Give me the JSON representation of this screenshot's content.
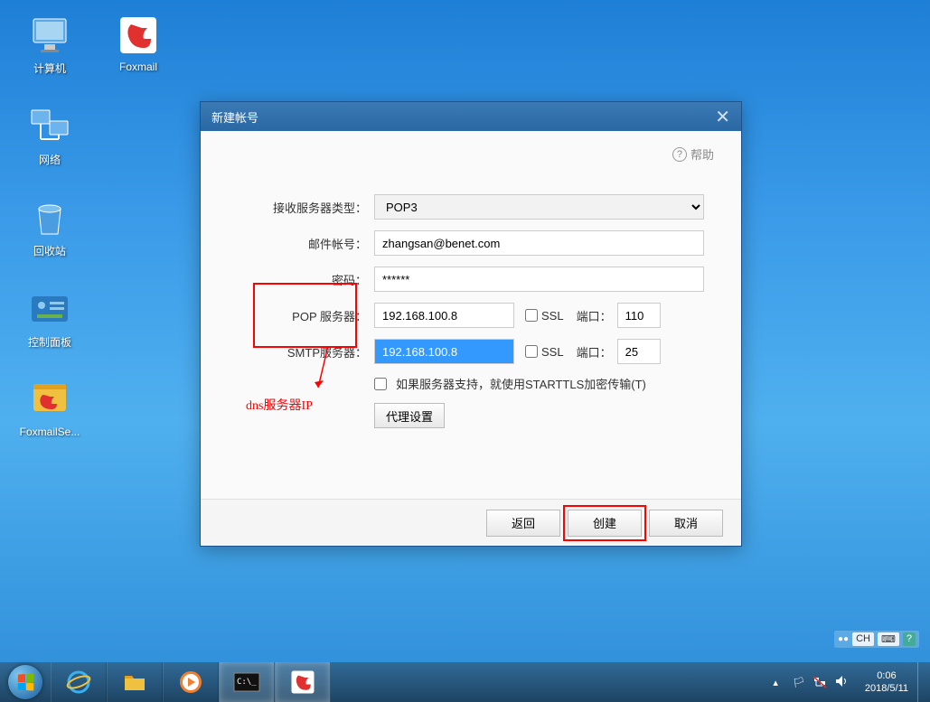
{
  "desktop": {
    "computer": "计算机",
    "foxmail": "Foxmail",
    "network": "网络",
    "recycle": "回收站",
    "control_panel": "控制面板",
    "foxmail_server": "FoxmailSe..."
  },
  "dialog": {
    "title": "新建帐号",
    "help": "帮助",
    "labels": {
      "server_type": "接收服务器类型：",
      "email": "邮件帐号：",
      "password": "密码：",
      "pop_server": "POP 服务器：",
      "smtp_server": "SMTP服务器：",
      "ssl": "SSL",
      "port": "端口：",
      "starttls": "如果服务器支持，就使用STARTTLS加密传输(T)"
    },
    "values": {
      "server_type": "POP3",
      "email": "zhangsan@benet.com",
      "password": "******",
      "pop_server": "192.168.100.8",
      "pop_port": "110",
      "smtp_server": "192.168.100.8",
      "smtp_port": "25"
    },
    "proxy_btn": "代理设置",
    "buttons": {
      "back": "返回",
      "create": "创建",
      "cancel": "取消"
    }
  },
  "annotation": "dns服务器IP",
  "ime": {
    "lang": "CH",
    "kbd": "⌨"
  },
  "tray": {
    "time": "0:06",
    "date": "2018/5/11"
  }
}
